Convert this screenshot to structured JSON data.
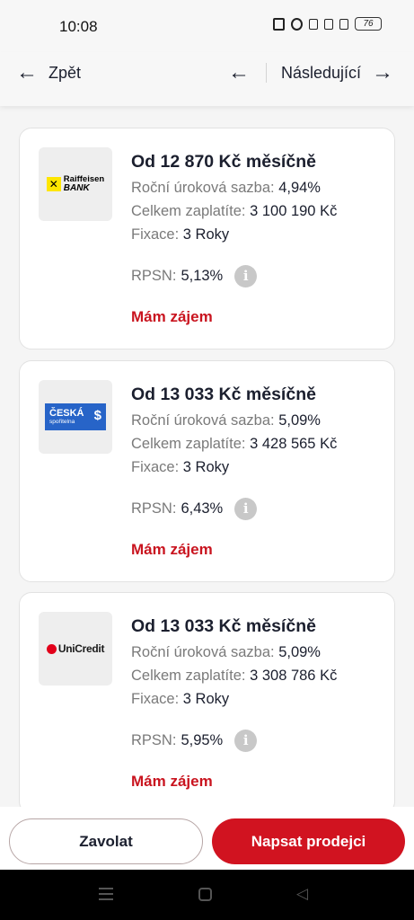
{
  "status_bar": {
    "time": "10:08",
    "icons": [
      "nfc-icon",
      "alarm-icon",
      "bluetooth-icon",
      "volte-icon",
      "signal-4g-icon"
    ],
    "battery": "76"
  },
  "nav": {
    "back_label": "Zpět",
    "next_label": "Následující"
  },
  "offers": [
    {
      "bank": "Raiffeisen BANK",
      "logo_line1": "Raiffeisen",
      "logo_line2": "BANK",
      "headline": "Od 12 870 Kč měsíčně",
      "rate_label": "Roční úroková sazba:",
      "rate": "4,94%",
      "total_label": "Celkem zaplatíte:",
      "total": "3 100 190 Kč",
      "fixation_label": "Fixace:",
      "fixation": "3 Roky",
      "rpsn_label": "RPSN:",
      "rpsn": "5,13%",
      "cta": "Mám zájem"
    },
    {
      "bank": "Česká spořitelna",
      "logo_line1": "ČESKÁ",
      "logo_line2": "spořitelna",
      "headline": "Od 13 033 Kč měsíčně",
      "rate_label": "Roční úroková sazba:",
      "rate": "5,09%",
      "total_label": "Celkem zaplatíte:",
      "total": "3 428 565 Kč",
      "fixation_label": "Fixace:",
      "fixation": "3 Roky",
      "rpsn_label": "RPSN:",
      "rpsn": "6,43%",
      "cta": "Mám zájem"
    },
    {
      "bank": "UniCredit",
      "logo_line1": "UniCredit",
      "headline": "Od 13 033 Kč měsíčně",
      "rate_label": "Roční úroková sazba:",
      "rate": "5,09%",
      "total_label": "Celkem zaplatíte:",
      "total": "3 308 786 Kč",
      "fixation_label": "Fixace:",
      "fixation": "3 Roky",
      "rpsn_label": "RPSN:",
      "rpsn": "5,95%",
      "cta": "Mám zájem"
    }
  ],
  "actions": {
    "call_label": "Zavolat",
    "write_label": "Napsat prodejci"
  },
  "colors": {
    "brand_red": "#d11320",
    "link_red": "#c9141f",
    "text_dark": "#1b1f2e",
    "text_muted": "#7a7a7a"
  }
}
